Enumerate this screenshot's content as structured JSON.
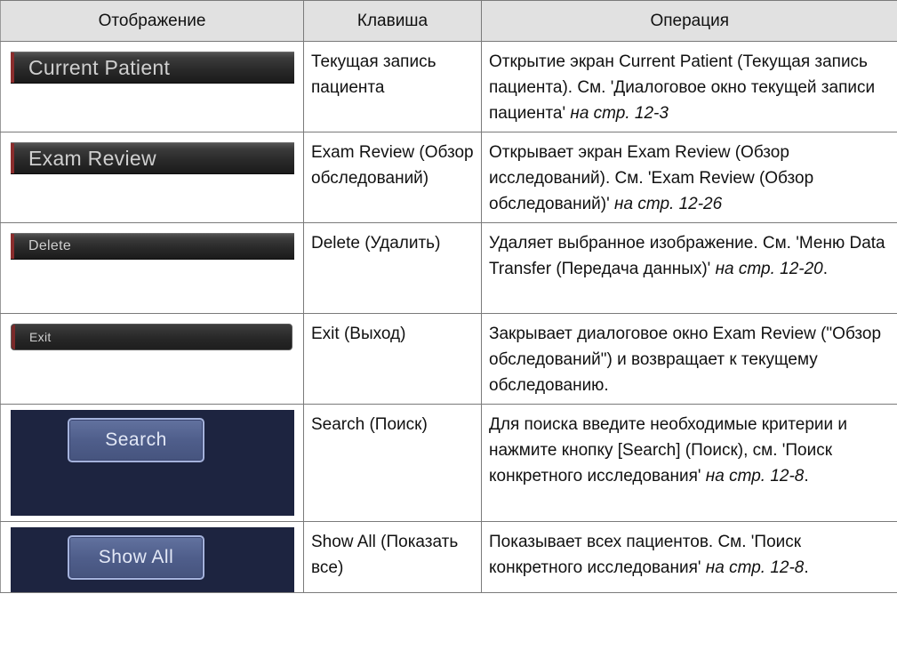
{
  "table": {
    "headers": {
      "display": "Отображение",
      "key": "Клавиша",
      "operation": "Операция"
    },
    "rows": [
      {
        "display_label": "Current Patient",
        "key": "Текущая запись пациента",
        "op_text": "Открытие экран Current Patient (Текущая запись пациента). См. 'Диалоговое окно текущей записи пациента' ",
        "op_ref": "на стр. 12-3",
        "op_tail": ""
      },
      {
        "display_label": "Exam Review",
        "key": "Exam Review (Обзор обследований)",
        "op_text": "Открывает экран Exam Review (Обзор исследований). См. 'Exam Review (Обзор обследований)' ",
        "op_ref": "на стр. 12-26",
        "op_tail": ""
      },
      {
        "display_label": "Delete",
        "key": "Delete (Удалить)",
        "op_text": "Удаляет выбранное изображение. См. 'Меню Data Transfer (Передача данных)' ",
        "op_ref": "на стр. 12-20",
        "op_tail": "."
      },
      {
        "display_label": "Exit",
        "key": "Exit (Выход)",
        "op_text": "Закрывает диалоговое окно Exam Review (\"Обзор обследований\") и возвращает к текущему обследованию.",
        "op_ref": "",
        "op_tail": ""
      },
      {
        "display_label": "Search",
        "key": "Search (Поиск)",
        "op_text": "Для поиска введите необходимые критерии и нажмите кнопку [Search] (Поиск), см. 'Поиск конкретного исследования' ",
        "op_ref": "на стр. 12-8",
        "op_tail": "."
      },
      {
        "display_label": "Show All",
        "key": "Show All (Показать все)",
        "op_text": "Показывает всех пациентов. См. 'Поиск конкретного исследования' ",
        "op_ref": "на стр. 12-8",
        "op_tail": "."
      }
    ]
  }
}
